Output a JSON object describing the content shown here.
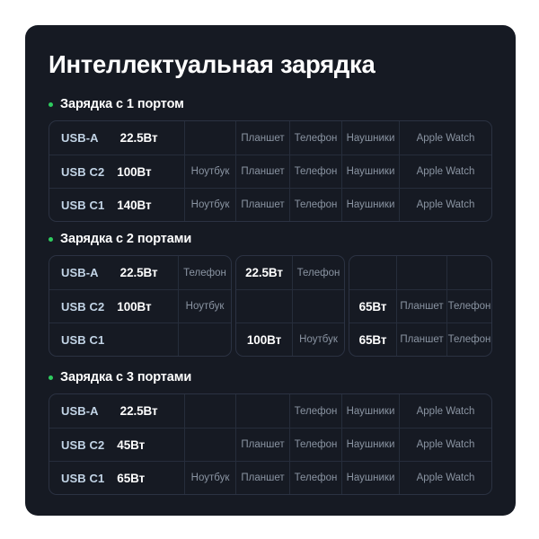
{
  "page": {
    "title": "Интеллектуальная зарядка",
    "bg_color": "#ffffff",
    "card_color": "#161a23",
    "bullet_color": "#2ecc5f",
    "port_label_color": "#c2d4e6",
    "watt_color": "#ffffff",
    "device_color": "#8a94a2",
    "border_color": "#2b3242"
  },
  "sections": [
    {
      "title": "Зарядка с 1 портом",
      "rows": [
        {
          "port": "USB-A",
          "watt": "22.5Вт",
          "cells": [
            "",
            "Планшет",
            "Телефон",
            "Наушники",
            "Apple Watch"
          ]
        },
        {
          "port": "USB C2",
          "watt": "100Вт",
          "cells": [
            "Ноутбук",
            "Планшет",
            "Телефон",
            "Наушники",
            "Apple Watch"
          ]
        },
        {
          "port": "USB C1",
          "watt": "140Вт",
          "cells": [
            "Ноутбук",
            "Планшет",
            "Телефон",
            "Наушники",
            "Apple Watch"
          ]
        }
      ]
    },
    {
      "title": "Зарядка с 2 портами",
      "groups": [
        {
          "rows": [
            {
              "port": "USB-A",
              "watt": "22.5Вт",
              "device": "Телефон"
            },
            {
              "port": "USB C2",
              "watt": "100Вт",
              "device": "Ноутбук"
            },
            {
              "port": "USB C1",
              "watt": "",
              "device": ""
            }
          ]
        },
        {
          "rows": [
            {
              "watt": "22.5Вт",
              "device": "Телефон"
            },
            {
              "watt": "",
              "device": ""
            },
            {
              "watt": "100Вт",
              "device": "Ноутбук"
            }
          ]
        },
        {
          "rows": [
            {
              "watt": "",
              "device1": "",
              "device2": ""
            },
            {
              "watt": "65Вт",
              "device1": "Планшет",
              "device2": "Телефон"
            },
            {
              "watt": "65Вт",
              "device1": "Планшет",
              "device2": "Телефон"
            }
          ]
        }
      ]
    },
    {
      "title": "Зарядка с 3 портами",
      "rows": [
        {
          "port": "USB-A",
          "watt": "22.5Вт",
          "cells": [
            "",
            "",
            "Телефон",
            "Наушники",
            "Apple Watch"
          ]
        },
        {
          "port": "USB C2",
          "watt": "45Вт",
          "cells": [
            "",
            "Планшет",
            "Телефон",
            "Наушники",
            "Apple Watch"
          ]
        },
        {
          "port": "USB C1",
          "watt": "65Вт",
          "cells": [
            "Ноутбук",
            "Планшет",
            "Телефон",
            "Наушники",
            "Apple Watch"
          ]
        }
      ]
    }
  ]
}
